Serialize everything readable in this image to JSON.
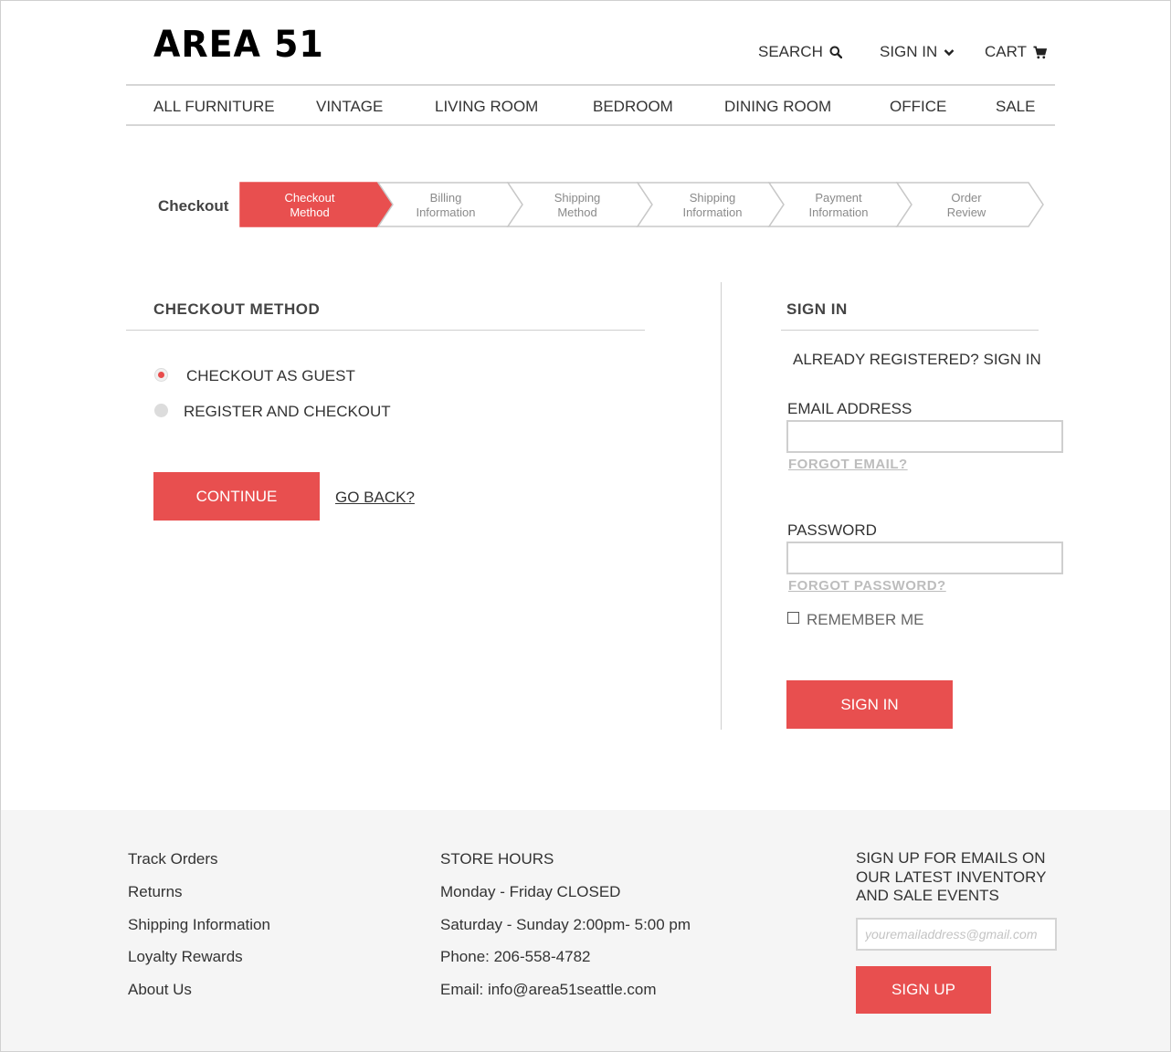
{
  "brand": {
    "logo": "AREA 51"
  },
  "header": {
    "search_label": "SEARCH",
    "signin_label": "SIGN IN",
    "cart_label": "CART"
  },
  "nav": {
    "items": [
      "ALL FURNITURE",
      "VINTAGE",
      "LIVING ROOM",
      "BEDROOM",
      "DINING ROOM",
      "OFFICE",
      "SALE"
    ]
  },
  "progress": {
    "label": "Checkout",
    "steps": [
      {
        "line1": "Checkout",
        "line2": "Method",
        "active": true
      },
      {
        "line1": "Billing",
        "line2": "Information",
        "active": false
      },
      {
        "line1": "Shipping",
        "line2": "Method",
        "active": false
      },
      {
        "line1": "Shipping",
        "line2": "Information",
        "active": false
      },
      {
        "line1": "Payment",
        "line2": "Information",
        "active": false
      },
      {
        "line1": "Order",
        "line2": "Review",
        "active": false
      }
    ]
  },
  "checkout_method": {
    "title": "CHECKOUT METHOD",
    "options": [
      {
        "label": "CHECKOUT AS GUEST",
        "selected": true
      },
      {
        "label": "REGISTER AND CHECKOUT",
        "selected": false
      }
    ],
    "continue_label": "CONTINUE",
    "back_label": "GO BACK?"
  },
  "signin": {
    "title": "SIGN IN",
    "subtitle": "ALREADY REGISTERED? SIGN IN",
    "email_label": "EMAIL ADDRESS",
    "email_value": "",
    "forgot_email": "FORGOT EMAIL?",
    "password_label": "PASSWORD",
    "password_value": "",
    "forgot_password": "FORGOT PASSWORD?",
    "remember_label": "REMEMBER ME",
    "remember_checked": false,
    "button_label": "SIGN IN"
  },
  "footer": {
    "links": [
      "Track Orders",
      "Returns",
      "Shipping Information",
      "Loyalty Rewards",
      "About Us"
    ],
    "store_hours_title": "STORE HOURS",
    "store_lines": [
      "Monday - Friday CLOSED",
      "Saturday - Sunday 2:00pm- 5:00 pm",
      "Phone: 206-558-4782",
      "Email: info@area51seattle.com"
    ],
    "signup_text": "SIGN UP FOR EMAILS ON OUR LATEST INVENTORY AND SALE EVENTS",
    "email_placeholder": "youremailaddress@gmail.com",
    "signup_button": "SIGN UP"
  },
  "colors": {
    "accent": "#e84f4f",
    "rule": "#cfcfcf",
    "footer_bg": "#f5f5f5"
  },
  "icons": [
    "search-icon",
    "chevron-down-icon",
    "cart-icon"
  ]
}
